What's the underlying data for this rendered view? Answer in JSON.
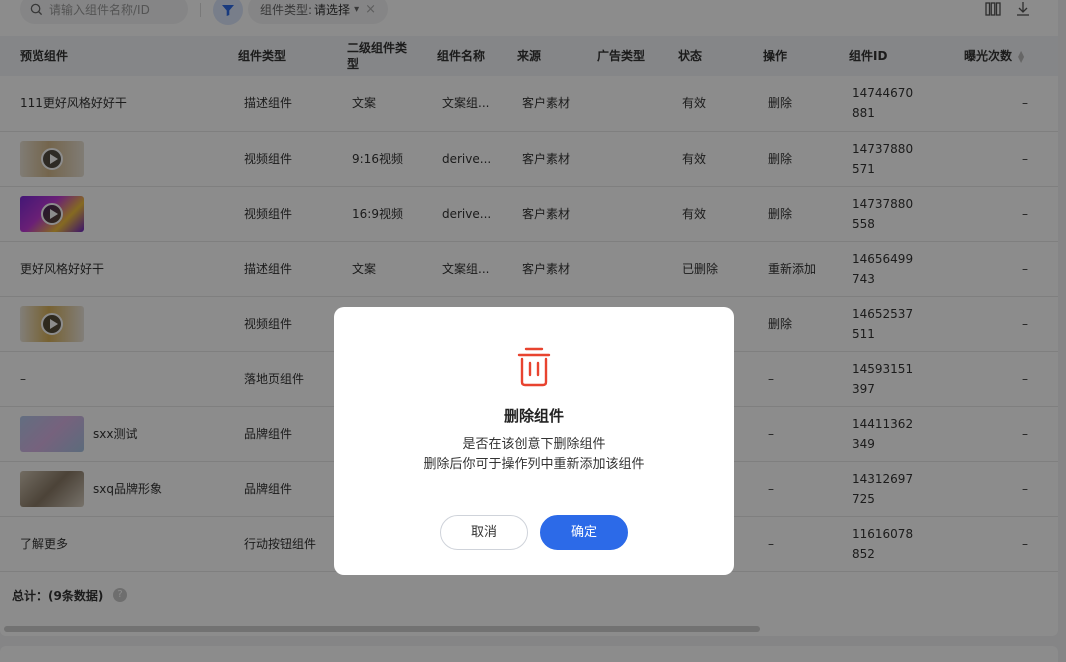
{
  "toolbar": {
    "search_placeholder": "请输入组件名称/ID",
    "type_filter_label": "组件类型:",
    "type_filter_value": "请选择"
  },
  "table": {
    "headers": [
      "预览组件",
      "组件类型",
      "二级组件类型",
      "组件名称",
      "来源",
      "广告类型",
      "状态",
      "操作",
      "组件ID",
      "曝光次数"
    ],
    "rows": [
      {
        "preview": "111更好风格好好干",
        "type": "描述组件",
        "subtype": "文案",
        "name": "文案组...",
        "source": "客户素材",
        "ad_type": "",
        "status": "有效",
        "action": "删除",
        "id": [
          "14744670",
          "881"
        ],
        "views": "–"
      },
      {
        "preview": "",
        "type": "视频组件",
        "subtype": "9:16视频",
        "name": "derive...",
        "source": "客户素材",
        "ad_type": "",
        "status": "有效",
        "action": "删除",
        "id": [
          "14737880",
          "571"
        ],
        "views": "–"
      },
      {
        "preview": "",
        "type": "视频组件",
        "subtype": "16:9视频",
        "name": "derive...",
        "source": "客户素材",
        "ad_type": "",
        "status": "有效",
        "action": "删除",
        "id": [
          "14737880",
          "558"
        ],
        "views": "–"
      },
      {
        "preview": "更好风格好好干",
        "type": "描述组件",
        "subtype": "文案",
        "name": "文案组...",
        "source": "客户素材",
        "ad_type": "",
        "status": "已删除",
        "action": "重新添加",
        "id": [
          "14656499",
          "743"
        ],
        "views": "–"
      },
      {
        "preview": "",
        "type": "视频组件",
        "subtype": "",
        "name": "",
        "source": "",
        "ad_type": "",
        "status": "",
        "action": "删除",
        "id": [
          "14652537",
          "511"
        ],
        "views": "–"
      },
      {
        "preview": "–",
        "type": "落地页组件",
        "subtype": "",
        "name": "",
        "source": "",
        "ad_type": "",
        "status": "",
        "action": "–",
        "id": [
          "14593151",
          "397"
        ],
        "views": "–"
      },
      {
        "preview": "sxx测试",
        "type": "品牌组件",
        "subtype": "",
        "name": "",
        "source": "",
        "ad_type": "",
        "status": "",
        "action": "–",
        "id": [
          "14411362",
          "349"
        ],
        "views": "–"
      },
      {
        "preview": "sxq品牌形象",
        "type": "品牌组件",
        "subtype": "",
        "name": "",
        "source": "",
        "ad_type": "",
        "status": "",
        "action": "–",
        "id": [
          "14312697",
          "725"
        ],
        "views": "–"
      },
      {
        "preview": "了解更多",
        "type": "行动按钮组件",
        "subtype": "",
        "name": "",
        "source": "",
        "ad_type": "",
        "status": "",
        "action": "–",
        "id": [
          "11616078",
          "852"
        ],
        "views": "–"
      }
    ]
  },
  "footer": {
    "total": "总计：(9条数据)",
    "help": "?"
  },
  "modal": {
    "title": "删除组件",
    "message_line1": "是否在该创意下删除组件",
    "message_line2": "删除后你可于操作列中重新添加该组件",
    "cancel": "取消",
    "confirm": "确定"
  },
  "colors": {
    "primary": "#2c6ae8",
    "danger": "#e8432f",
    "mask": "rgba(0,0,0,0.45)"
  },
  "icons": {
    "search": "search-icon",
    "filter": "filter-icon",
    "columns": "columns-icon",
    "download": "download-icon",
    "trash": "trash-icon",
    "play": "play-icon"
  }
}
